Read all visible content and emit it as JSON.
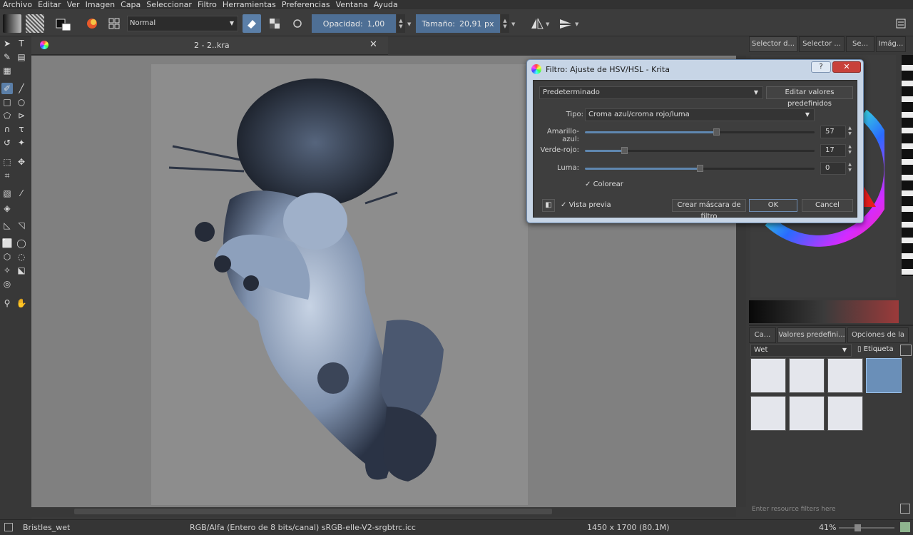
{
  "menu": [
    "Archivo",
    "Editar",
    "Ver",
    "Imagen",
    "Capa",
    "Seleccionar",
    "Filtro",
    "Herramientas",
    "Preferencias",
    "Ventana",
    "Ayuda"
  ],
  "toolbar": {
    "blend_mode": "Normal",
    "opacity_label": "Opacidad:",
    "opacity_value": "1,00",
    "size_label": "Tamaño:",
    "size_value": "20,91 px"
  },
  "document": {
    "tab_title": "2 - 2..kra"
  },
  "dialog": {
    "title": "Filtro: Ajuste de HSV/HSL - Krita",
    "preset": "Predeterminado",
    "edit_presets_button": "Editar valores predefinidos",
    "type_label": "Tipo:",
    "type_value": "Croma azul/croma rojo/luma",
    "sliders": [
      {
        "label": "Amarillo-azul:",
        "value": "57",
        "fraction": 0.57
      },
      {
        "label": "Verde-rojo:",
        "value": "17",
        "fraction": 0.17
      },
      {
        "label": "Luma:",
        "value": "0",
        "fraction": 0.5
      }
    ],
    "colorize_label": "Colorear",
    "preview_label": "Vista previa",
    "mask_button": "Crear máscara de filtro",
    "ok_button": "OK",
    "cancel_button": "Cancel",
    "help_button": "?"
  },
  "right_dock": {
    "top_tabs": [
      "Selector d...",
      "Selector ...",
      "Se...",
      "Imág..."
    ],
    "bottom_tabs": [
      "Ca...",
      "Valores predefini...",
      "Opciones de la ..."
    ],
    "preset_filter": "Wet",
    "tag_label": "Etiqueta",
    "resource_filter_placeholder": "Enter resource filters here"
  },
  "status": {
    "brush": "Bristles_wet",
    "colorspace": "RGB/Alfa (Entero de 8 bits/canal)  sRGB-elle-V2-srgbtrc.icc",
    "dimensions": "1450 x 1700 (80.1M)",
    "zoom": "41%"
  },
  "colors": {
    "accent": "#5b7fa8",
    "canvas": "#808080",
    "dialog_frame": "#c7d5e6"
  }
}
